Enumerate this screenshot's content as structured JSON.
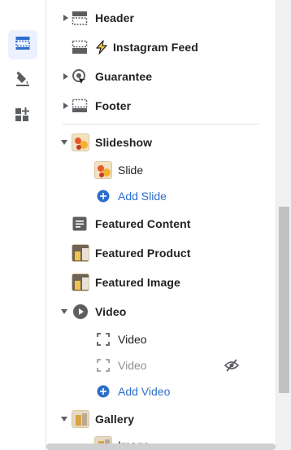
{
  "rail": {
    "items": [
      {
        "name": "sections",
        "icon": "sections-icon",
        "active": true
      },
      {
        "name": "theme-settings",
        "icon": "paint-bucket-icon",
        "active": false
      },
      {
        "name": "app-embeds",
        "icon": "add-apps-icon",
        "active": false
      }
    ]
  },
  "tree": {
    "header": {
      "label": "Header"
    },
    "instagram": {
      "label": "Instagram Feed"
    },
    "guarantee": {
      "label": "Guarantee"
    },
    "footer": {
      "label": "Footer"
    },
    "slideshow": {
      "label": "Slideshow"
    },
    "slide": {
      "label": "Slide"
    },
    "add_slide": {
      "label": "Add Slide"
    },
    "featured_content": {
      "label": "Featured Content"
    },
    "featured_product": {
      "label": "Featured Product"
    },
    "featured_image": {
      "label": "Featured Image"
    },
    "video": {
      "label": "Video"
    },
    "video_block_1": {
      "label": "Video"
    },
    "video_block_2": {
      "label": "Video",
      "hidden": true
    },
    "add_video": {
      "label": "Add Video"
    },
    "gallery": {
      "label": "Gallery"
    },
    "image": {
      "label": "Image"
    }
  },
  "colors": {
    "accent": "#2c6ecb",
    "active_rail_bg": "#edf1ff",
    "text": "#202223",
    "muted": "#8c9196",
    "divider": "#e1e3e5"
  }
}
